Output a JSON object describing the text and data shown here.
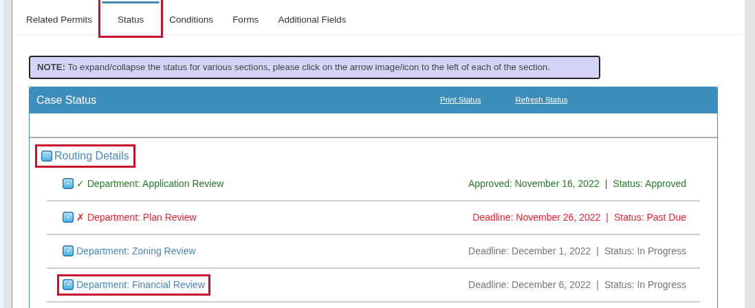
{
  "tabs": [
    {
      "label": "Related Permits",
      "selected": false,
      "highlighted": false
    },
    {
      "label": "Status",
      "selected": true,
      "highlighted": true
    },
    {
      "label": "Conditions",
      "selected": false,
      "highlighted": false
    },
    {
      "label": "Forms",
      "selected": false,
      "highlighted": false
    },
    {
      "label": "Additional Fields",
      "selected": false,
      "highlighted": false
    }
  ],
  "note": "**NOTE:** To expand/collapse the status for various sections, please click on the arrow image/icon to the left of each of the section.",
  "panel": {
    "title": "Case Status",
    "links": [
      "Print Status",
      "Refresh Status"
    ]
  },
  "section": {
    "title": "Routing Details",
    "expanded": true,
    "highlighted": true,
    "rows": [
      {
        "kind": "approved",
        "mark": "✓",
        "title": "Department: Application Review",
        "date": "Approved: November 16, 2022",
        "separator": "|",
        "status": "Status: Approved",
        "highlighted": false
      },
      {
        "kind": "past_due",
        "mark": "✗",
        "title": "Department: Plan Review",
        "date": "Deadline: November 26, 2022",
        "separator": "|",
        "status": "Status: Past Due",
        "highlighted": false
      },
      {
        "kind": "in_progress",
        "title": "Department: Zoning Review",
        "date": "Deadline: December 1, 2022",
        "separator": "|",
        "status": "Status: In Progress",
        "highlighted": false
      },
      {
        "kind": "in_progress",
        "title": "Department: Financial Review",
        "date": "Deadline: December 6, 2022",
        "separator": "|",
        "status": "Status: In Progress",
        "highlighted": true
      }
    ]
  }
}
